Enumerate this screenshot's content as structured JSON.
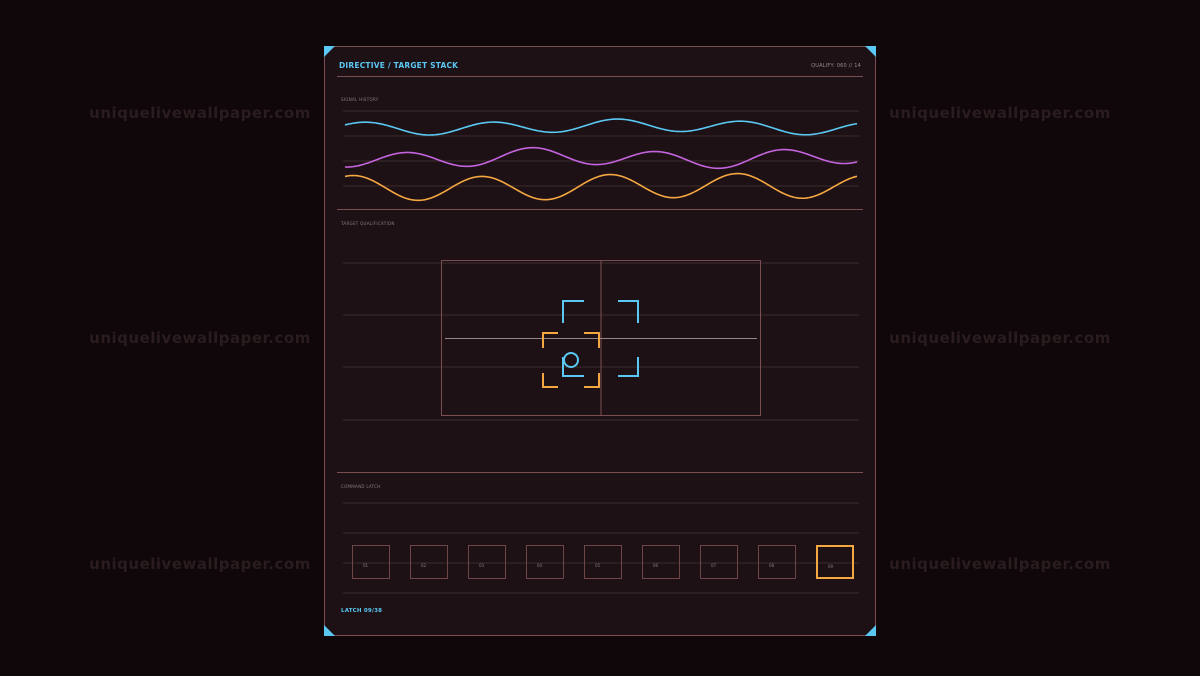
{
  "watermark": "uniquelivewallpaper.com",
  "panel": {
    "title": "DIRECTIVE / TARGET STACK",
    "status": "QUALIFY: 060 // 14"
  },
  "sections": {
    "signal_history": "SIGNAL HISTORY",
    "target_qualification": "TARGET QUALIFICATION",
    "command_latch": "COMMAND LATCH"
  },
  "latch": {
    "status": "LATCH 09/38",
    "slots": [
      {
        "label": "01",
        "active": false
      },
      {
        "label": "02",
        "active": false
      },
      {
        "label": "03",
        "active": false
      },
      {
        "label": "04",
        "active": false
      },
      {
        "label": "05",
        "active": false
      },
      {
        "label": "06",
        "active": false
      },
      {
        "label": "07",
        "active": false
      },
      {
        "label": "08",
        "active": false
      },
      {
        "label": "09",
        "active": true
      }
    ]
  },
  "colors": {
    "frame": "#7a4e52",
    "accent_cyan": "#5ac8f2",
    "accent_magenta": "#c664e0",
    "accent_orange": "#f5a742",
    "panel_bg": "#1d1115",
    "page_bg": "#0f0709"
  },
  "signals": [
    {
      "name": "cyan",
      "color": "#5ac8f2"
    },
    {
      "name": "magenta",
      "color": "#c664e0"
    },
    {
      "name": "orange",
      "color": "#f5a742"
    }
  ]
}
